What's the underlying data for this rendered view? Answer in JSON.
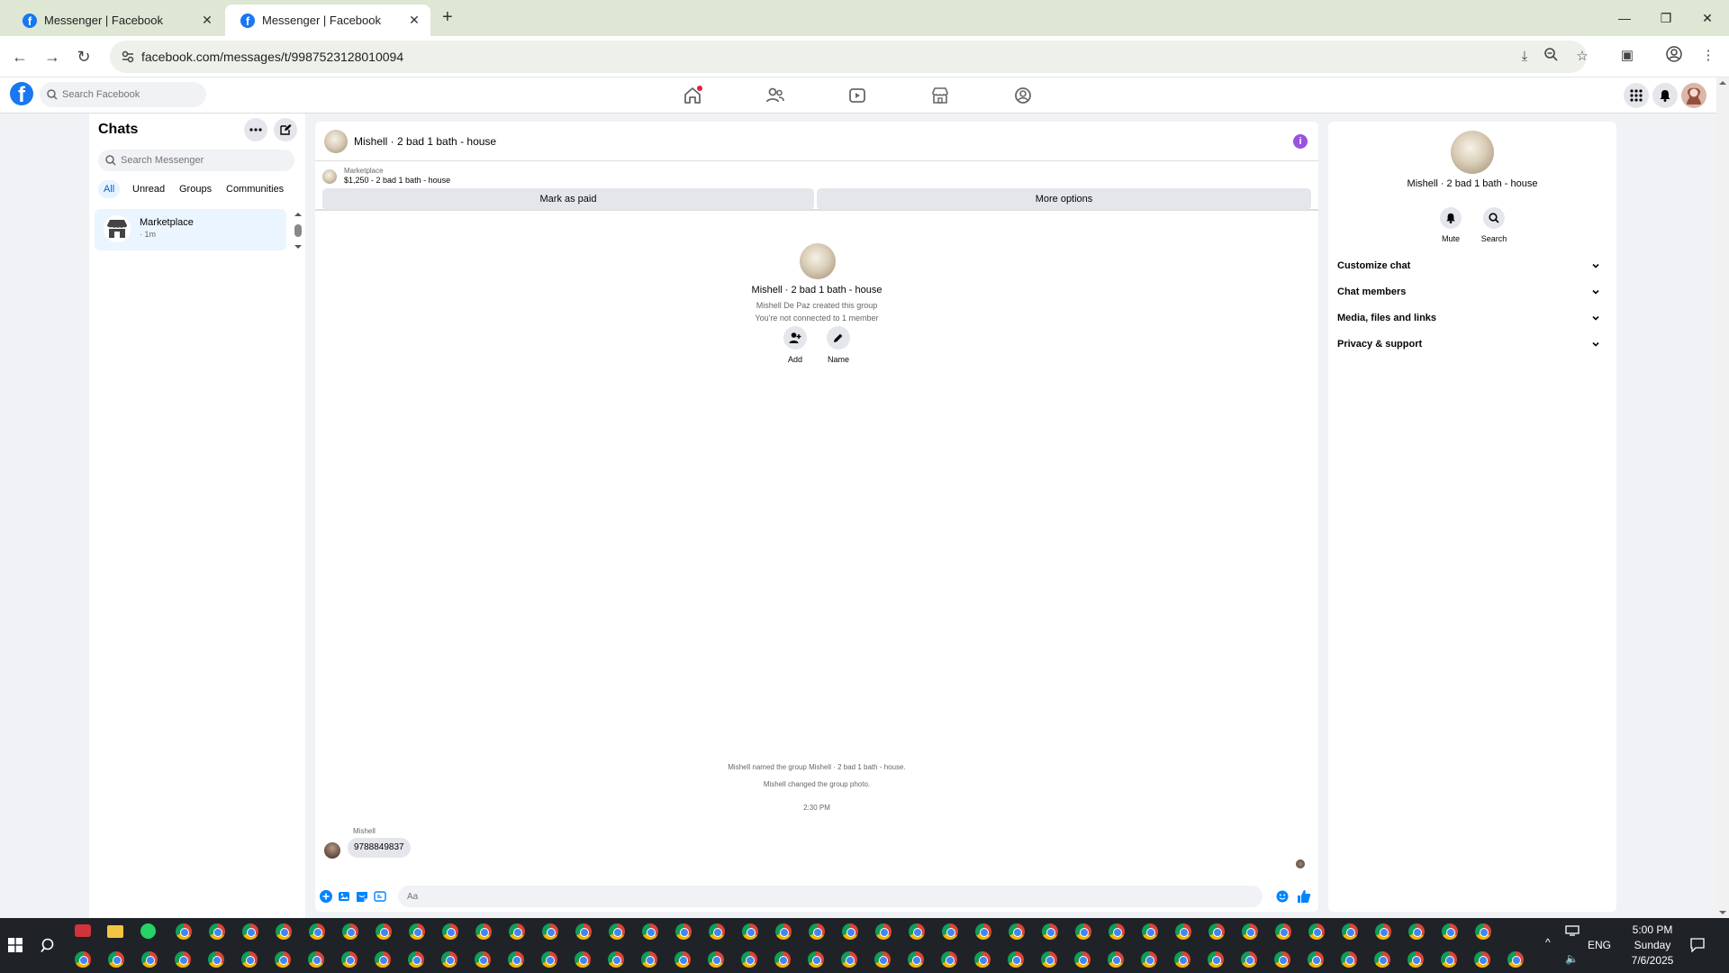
{
  "browser": {
    "tabs": [
      {
        "title": "Messenger | Facebook"
      },
      {
        "title": "Messenger | Facebook"
      }
    ],
    "url": "facebook.com/messages/t/9987523128010094"
  },
  "facebook": {
    "search_placeholder": "Search Facebook"
  },
  "chats": {
    "title": "Chats",
    "search_placeholder": "Search Messenger",
    "filters": [
      "All",
      "Unread",
      "Groups",
      "Communities"
    ],
    "items": [
      {
        "name": "Marketplace",
        "time": "· 1m"
      }
    ]
  },
  "conversation": {
    "title": "Mishell · 2 bad 1 bath - house",
    "pinned": {
      "label": "Marketplace",
      "listing": "$1,250 - 2 bad 1 bath - house",
      "mark_paid": "Mark as paid",
      "more_options": "More options"
    },
    "intro": {
      "name": "Mishell · 2 bad 1 bath - house",
      "created": "Mishell De Paz created this group",
      "connection": "You're not connected to 1 member",
      "add_label": "Add",
      "name_label": "Name"
    },
    "events": [
      "Mishell named the group Mishell · 2 bad 1 bath - house.",
      "Mishell changed the group photo."
    ],
    "timestamp": "2:30 PM",
    "message": {
      "sender": "Mishell",
      "text": "9788849837"
    },
    "input_placeholder": "Aa"
  },
  "info_panel": {
    "name": "Mishell · 2 bad 1 bath - house",
    "mute_label": "Mute",
    "search_label": "Search",
    "sections": [
      "Customize chat",
      "Chat members",
      "Media, files and links",
      "Privacy & support"
    ]
  },
  "taskbar": {
    "time": "5:00 PM",
    "day": "Sunday",
    "date": "7/6/2025",
    "language": "ENG"
  },
  "colors": {
    "fb_blue": "#1877f2",
    "messenger_blue": "#0084ff",
    "info_purple": "#9b51e0",
    "selected_chat": "#ebf5ff"
  }
}
